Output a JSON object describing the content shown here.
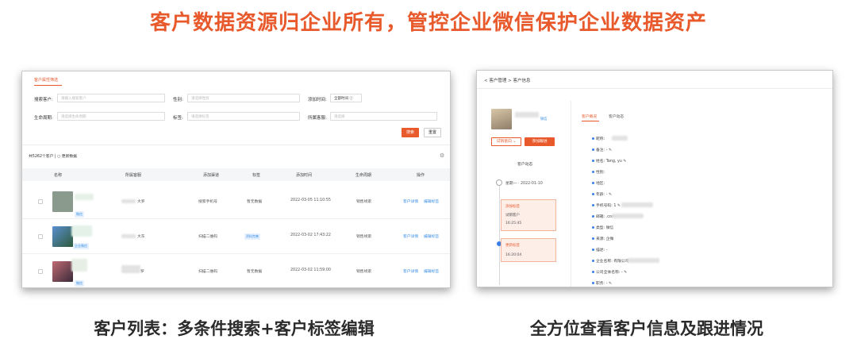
{
  "headline": "客户数据资源归企业所有，管控企业微信保护企业数据资产",
  "captions": {
    "left": "客户列表：多条件搜索+客户标签编辑",
    "right": "全方位查看客户信息及跟进情况"
  },
  "left": {
    "tab": "客户属性筛选",
    "filters": {
      "search_label": "搜索客户:",
      "search_placeholder": "请输入搜索客户",
      "gender_label": "性别:",
      "gender_placeholder": "请选择性别",
      "time_label": "添加时间:",
      "time_value": "全部时间 ⓘ",
      "lifecycle_label": "生命周期:",
      "lifecycle_placeholder": "请选择生命周期",
      "tag_label": "标签:",
      "tag_placeholder": "请选择标签",
      "owner_label": "所属客服:",
      "owner_placeholder": "请选择"
    },
    "buttons": {
      "search": "搜索",
      "reset": "重置"
    },
    "summary": "共5262个客户 | ○ 更新数据",
    "columns": [
      "名称",
      "所属客服",
      "添加渠道",
      "标签",
      "添加时间",
      "生命周期",
      "操作"
    ],
    "rows": [
      {
        "badge": "微信",
        "owner": "大罗",
        "channel": "搜索手机号",
        "tag": "暂无数据",
        "time": "2022-03-05 11:10:55",
        "lifecycle": "销售线索",
        "op1": "客户详情",
        "op2": "编辑标签",
        "thumb_color": "#8a9b8e"
      },
      {
        "badge": "企业微信",
        "owner": "大东",
        "channel": "扫描二维码",
        "tag": "资料完善",
        "time": "2022-03-02 17:43:22",
        "lifecycle": "销售线索",
        "op1": "客户详情",
        "op2": "编辑标签",
        "thumb_color": "#3d6fa8"
      },
      {
        "badge": "微信",
        "owner": "罗",
        "channel": "扫描二维码",
        "tag": "暂无数据",
        "time": "2022-03-02 11:59:00",
        "lifecycle": "销售线索",
        "op1": "客户详情",
        "op2": "编辑标签",
        "thumb_color": "#7b4a4e"
      }
    ]
  },
  "right": {
    "breadcrumb": "< 客户管理 > 客户信息",
    "avatar_tag": "微信",
    "dropdown": "试销意向 ⌄",
    "follow_button": "添加跟进",
    "timeline_title": "客户动态",
    "timeline_date": "星期一 · 2022-01-10",
    "events": [
      {
        "title": "添加标签",
        "detail": "试销客户",
        "time": "16:25:45"
      },
      {
        "title": "更新标签",
        "detail": "",
        "time": "16:20:04"
      }
    ],
    "tabs": [
      "客户概况",
      "客户动态"
    ],
    "info": [
      "昵称: ",
      "备注: - ✎",
      "姓名: Tang, yu ✎",
      "性别: ",
      "地区: ",
      "年龄: - ✎",
      "手机号码: 1 ✎",
      "邮箱: .com ✎",
      "类型: 微信",
      "来源: 企微",
      "描述: -",
      "企业名称: 有限公司 ✎",
      "公司全体名称: - ✎",
      "职务: - ✎"
    ]
  }
}
